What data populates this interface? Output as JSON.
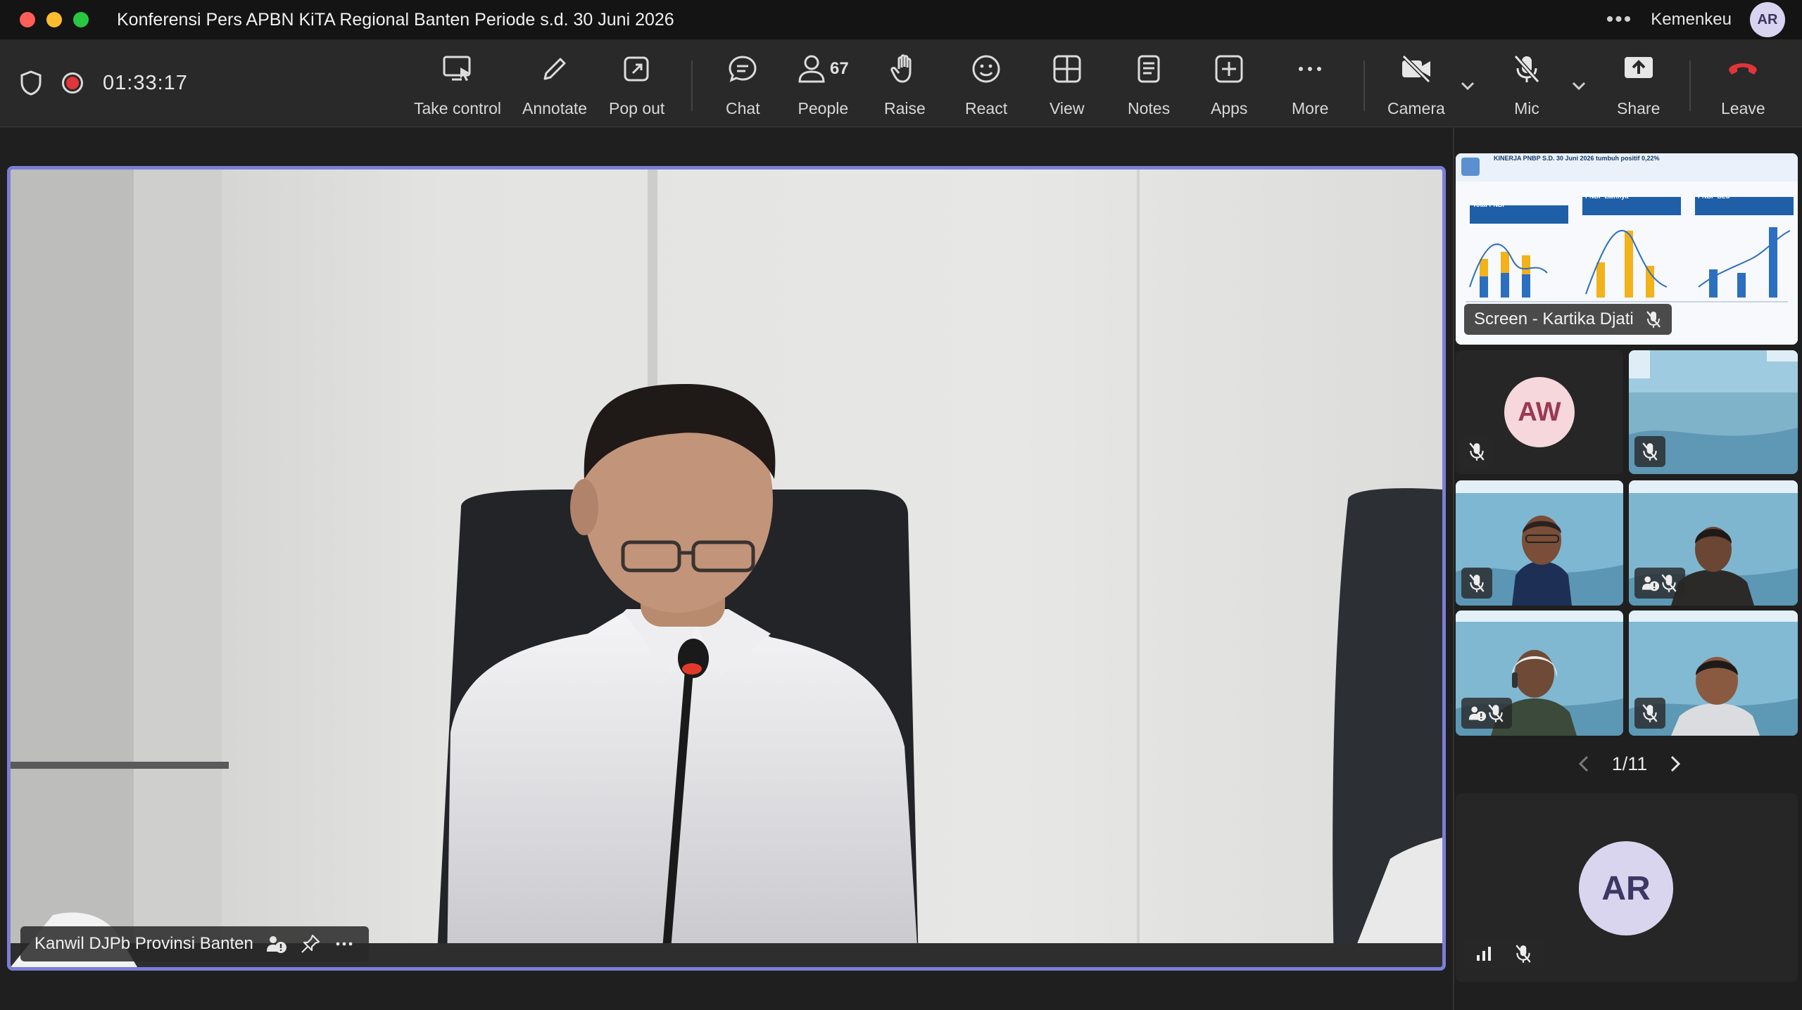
{
  "window": {
    "title": "Konferensi Pers APBN KiTA Regional Banten Periode s.d. 30 Juni 2026",
    "org": "Kemenkeu",
    "user_initials": "AR"
  },
  "toolbar": {
    "timer": "01:33:17",
    "buttons": {
      "take_control": "Take control",
      "annotate": "Annotate",
      "pop_out": "Pop out",
      "chat": "Chat",
      "people": "People",
      "people_count": "67",
      "raise": "Raise",
      "react": "React",
      "view": "View",
      "notes": "Notes",
      "apps": "Apps",
      "more": "More",
      "camera": "Camera",
      "mic": "Mic",
      "share": "Share",
      "leave": "Leave"
    },
    "colors": {
      "leave": "#e0353a",
      "record": "#e0353a"
    }
  },
  "stage": {
    "speaker_name": "Kanwil DJPb Provinsi Banten",
    "border_color": "#7b7fd6"
  },
  "sidebar": {
    "screen_share": {
      "label": "Screen - Kartika Djati",
      "slide_title": "KINERJA PNBP S.D. 30 Juni 2026 tumbuh positif 0,22%",
      "cards": [
        "Total PNBP",
        "PNBP Lainnya",
        "PNBP BLU"
      ]
    },
    "tiles": [
      {
        "type": "avatar",
        "initials": "AW",
        "muted": true
      },
      {
        "type": "video",
        "muted": true
      },
      {
        "type": "video",
        "muted": true
      },
      {
        "type": "video",
        "muted": true
      },
      {
        "type": "video",
        "muted": true
      },
      {
        "type": "video",
        "muted": true
      }
    ],
    "pager": "1/11",
    "self_view": {
      "initials": "AR",
      "muted": true
    }
  }
}
